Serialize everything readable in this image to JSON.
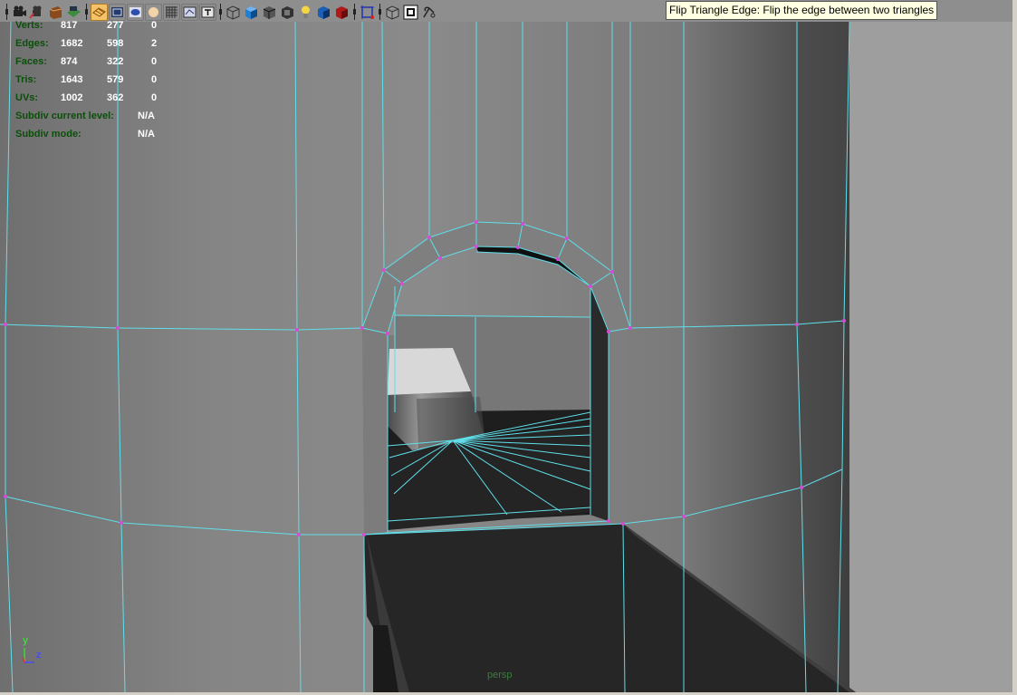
{
  "tooltip": {
    "text": "Flip Triangle Edge: Flip the edge between two triangles"
  },
  "toolbar": {
    "icons": [
      "camera-attributes-icon",
      "select-camera-icon",
      "bookmark-icon",
      "image-plane-icon",
      "grid-icon",
      "film-gate-icon",
      "resolution-gate-icon",
      "gate-mask-icon",
      "field-chart-icon",
      "safe-action-icon",
      "safe-title-icon",
      "wireframe-icon",
      "smooth-shade-icon",
      "wireframe-on-shaded-icon",
      "textured-icon",
      "use-all-lights-icon",
      "shadows-icon",
      "xray-icon",
      "isolate-select-icon",
      "xray-joints-icon",
      "xray-active-components-icon",
      "backface-culling-icon"
    ]
  },
  "hud": {
    "rows": [
      {
        "label": "Verts:",
        "values": [
          "817",
          "277",
          "0"
        ]
      },
      {
        "label": "Edges:",
        "values": [
          "1682",
          "598",
          "2"
        ]
      },
      {
        "label": "Faces:",
        "values": [
          "874",
          "322",
          "0"
        ]
      },
      {
        "label": "Tris:",
        "values": [
          "1643",
          "579",
          "0"
        ]
      },
      {
        "label": "UVs:",
        "values": [
          "1002",
          "362",
          "0"
        ]
      },
      {
        "label": "Subdiv current level:",
        "values": [
          "N/A"
        ]
      },
      {
        "label": "Subdiv mode:",
        "values": [
          "N/A"
        ]
      }
    ]
  },
  "axis": {
    "y": "y",
    "z": "z"
  },
  "viewport": {
    "camera_label": "persp"
  },
  "colors": {
    "wire": "#5fdfea",
    "vertex": "#d84ad8",
    "hud_label": "#0a4f0a",
    "tooltip_bg": "#ffffe1"
  }
}
